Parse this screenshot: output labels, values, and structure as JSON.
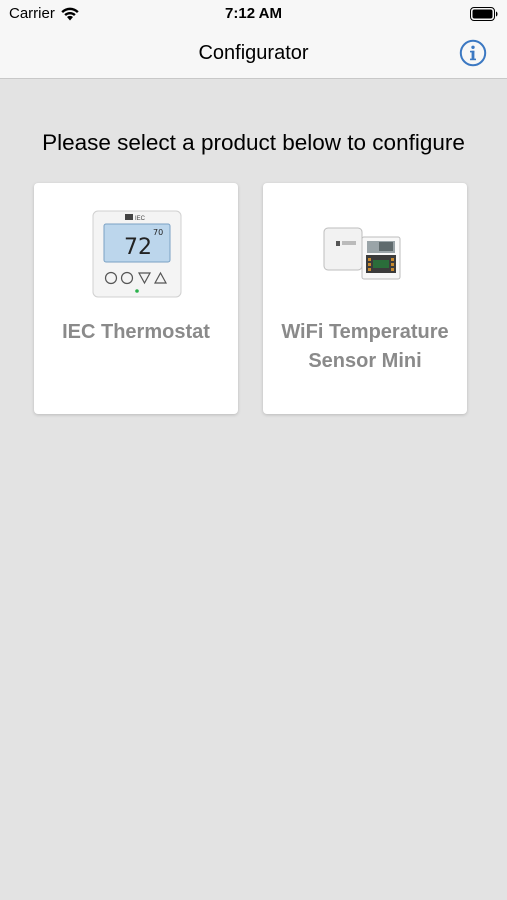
{
  "status_bar": {
    "carrier": "Carrier",
    "time": "7:12 AM"
  },
  "nav": {
    "title": "Configurator",
    "info_icon": "info-icon"
  },
  "prompt": "Please select a product below to configure",
  "products": [
    {
      "label": "IEC Thermostat",
      "icon": "thermostat-image",
      "display_reading": "72",
      "display_setpoint": "70"
    },
    {
      "label": "WiFi Temperature Sensor Mini",
      "icon": "wifi-sensor-image"
    }
  ],
  "colors": {
    "background": "#e3e3e3",
    "bar_background": "#f7f7f7",
    "accent": "#3b78c2",
    "card_label": "#8a8a8a"
  }
}
